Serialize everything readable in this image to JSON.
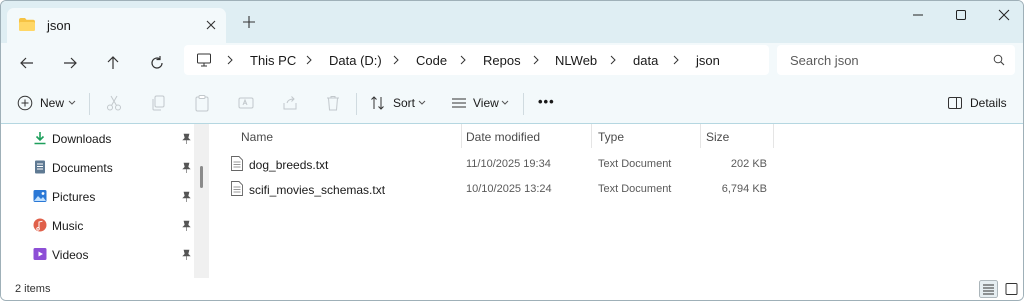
{
  "window": {
    "tab_title": "json",
    "tab_icon": "folder-icon",
    "accent_color": "#0067c0",
    "folder_color": "#f6c344"
  },
  "navigation": {
    "breadcrumbs": [
      "This PC",
      "Data (D:)",
      "Code",
      "Repos",
      "NLWeb",
      "data",
      "json"
    ],
    "search_placeholder": "Search json"
  },
  "commands": {
    "new_label": "New",
    "sort_label": "Sort",
    "view_label": "View",
    "details_label": "Details",
    "more_label": "•••"
  },
  "sidebar": {
    "items": [
      {
        "label": "Downloads",
        "icon": "download-icon",
        "color": "#1e9f5c"
      },
      {
        "label": "Documents",
        "icon": "document-icon",
        "color": "#5f7a93"
      },
      {
        "label": "Pictures",
        "icon": "pictures-icon",
        "color": "#2a78d6"
      },
      {
        "label": "Music",
        "icon": "music-icon",
        "color": "#e0604a"
      },
      {
        "label": "Videos",
        "icon": "videos-icon",
        "color": "#8d4fd6"
      }
    ]
  },
  "files": {
    "columns": [
      "Name",
      "Date modified",
      "Type",
      "Size"
    ],
    "rows": [
      {
        "name": "dog_breeds.txt",
        "date": "11/10/2025 19:34",
        "type": "Text Document",
        "size": "202 KB"
      },
      {
        "name": "scifi_movies_schemas.txt",
        "date": "10/10/2025 13:24",
        "type": "Text Document",
        "size": "6,794 KB"
      }
    ]
  },
  "status": {
    "item_count": "2 items"
  }
}
